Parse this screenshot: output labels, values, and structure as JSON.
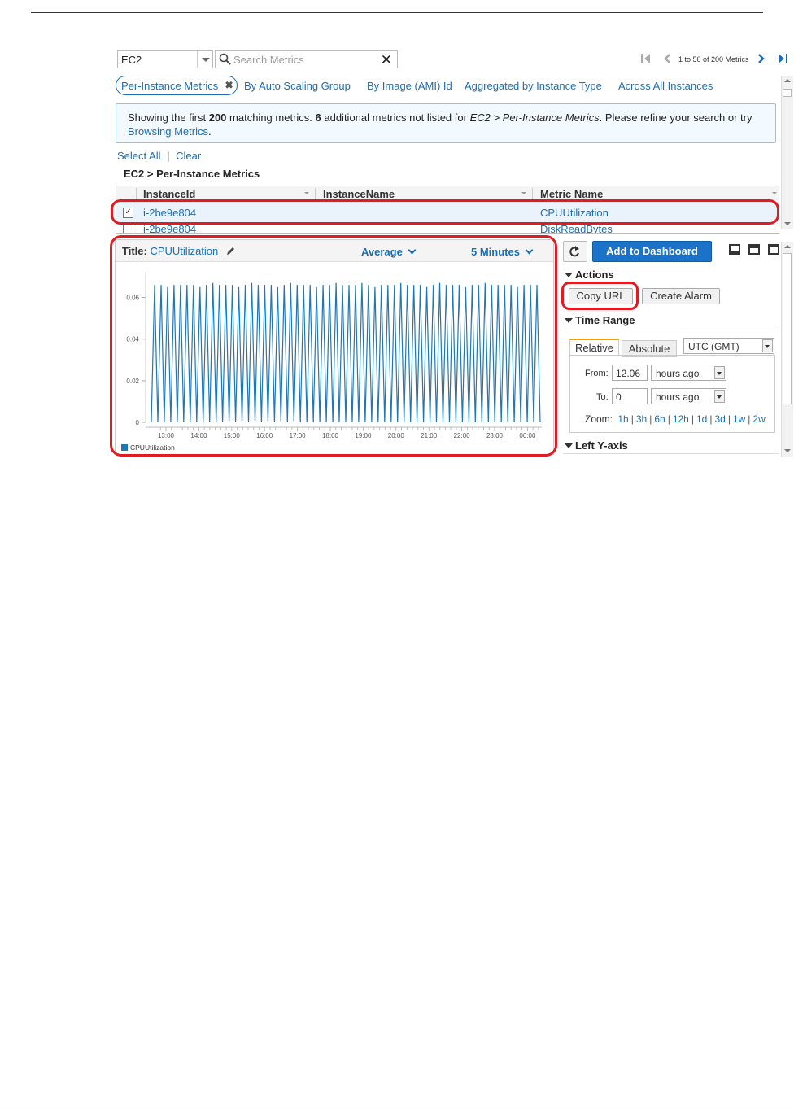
{
  "toolbar": {
    "namespace_value": "EC2",
    "search_placeholder": "Search Metrics",
    "pager_text": "1 to 50 of 200 Metrics"
  },
  "tabs": [
    {
      "label": "Per-Instance Metrics",
      "active": true
    },
    {
      "label": "By Auto Scaling Group"
    },
    {
      "label": "By Image (AMI) Id"
    },
    {
      "label": "Aggregated by Instance Type"
    },
    {
      "label": "Across All Instances"
    }
  ],
  "info": {
    "p1": "Showing the first ",
    "count": "200",
    "p2": " matching metrics. ",
    "additional": "6",
    "p3": " additional metrics not listed for ",
    "path": "EC2 > Per-Instance Metrics",
    "p4": ". Please refine your search or try",
    "link": "Browsing Metrics",
    "p5": "."
  },
  "selection": {
    "select_all": "Select All",
    "sep": "|",
    "clear": "Clear"
  },
  "breadcrumb": "EC2 > Per-Instance Metrics",
  "table": {
    "columns": [
      "InstanceId",
      "InstanceName",
      "Metric Name"
    ],
    "rows": [
      {
        "checked": true,
        "instance_id": "i-2be9e804",
        "instance_name": "",
        "metric": "CPUUtilization"
      },
      {
        "checked": false,
        "instance_id": "i-2be9e804",
        "instance_name": "",
        "metric": "DiskReadBytes"
      }
    ]
  },
  "graph": {
    "title_label": "Title:",
    "title_value": "CPUUtilization",
    "statistic": "Average",
    "period": "5 Minutes"
  },
  "chart_data": {
    "type": "line",
    "x_ticks": [
      "13:00",
      "14:00",
      "15:00",
      "16:00",
      "17:00",
      "18:00",
      "19:00",
      "20:00",
      "21:00",
      "22:00",
      "23:00",
      "00:00"
    ],
    "y_ticks": [
      "0",
      "0.02",
      "0.04",
      "0.06"
    ],
    "ylim": [
      0,
      0.07
    ],
    "grid": true,
    "legend": "bottom-left",
    "series": [
      {
        "name": "CPUUtilization",
        "color": "#1f77b4",
        "pattern": "oscillating 0 to ~0.066 every ~10 minutes from ~12:35 to ~00:25"
      }
    ]
  },
  "right": {
    "add_button": "Add to Dashboard",
    "actions_title": "Actions",
    "copy_url": "Copy URL",
    "create_alarm": "Create Alarm",
    "time_range_title": "Time Range",
    "relative_tab": "Relative",
    "absolute_tab": "Absolute",
    "timezone": "UTC (GMT)",
    "from_label": "From:",
    "from_value": "12.06",
    "from_unit": "hours ago",
    "to_label": "To:",
    "to_value": "0",
    "to_unit": "hours ago",
    "zoom_label": "Zoom:",
    "zoom_options": [
      "1h",
      "3h",
      "6h",
      "12h",
      "1d",
      "3d",
      "1w",
      "2w"
    ],
    "left_y_axis_title": "Left Y-axis"
  },
  "colors": {
    "accent": "#1a6fb5",
    "highlight": "#e21b23",
    "primary_button": "#1a73c8"
  }
}
